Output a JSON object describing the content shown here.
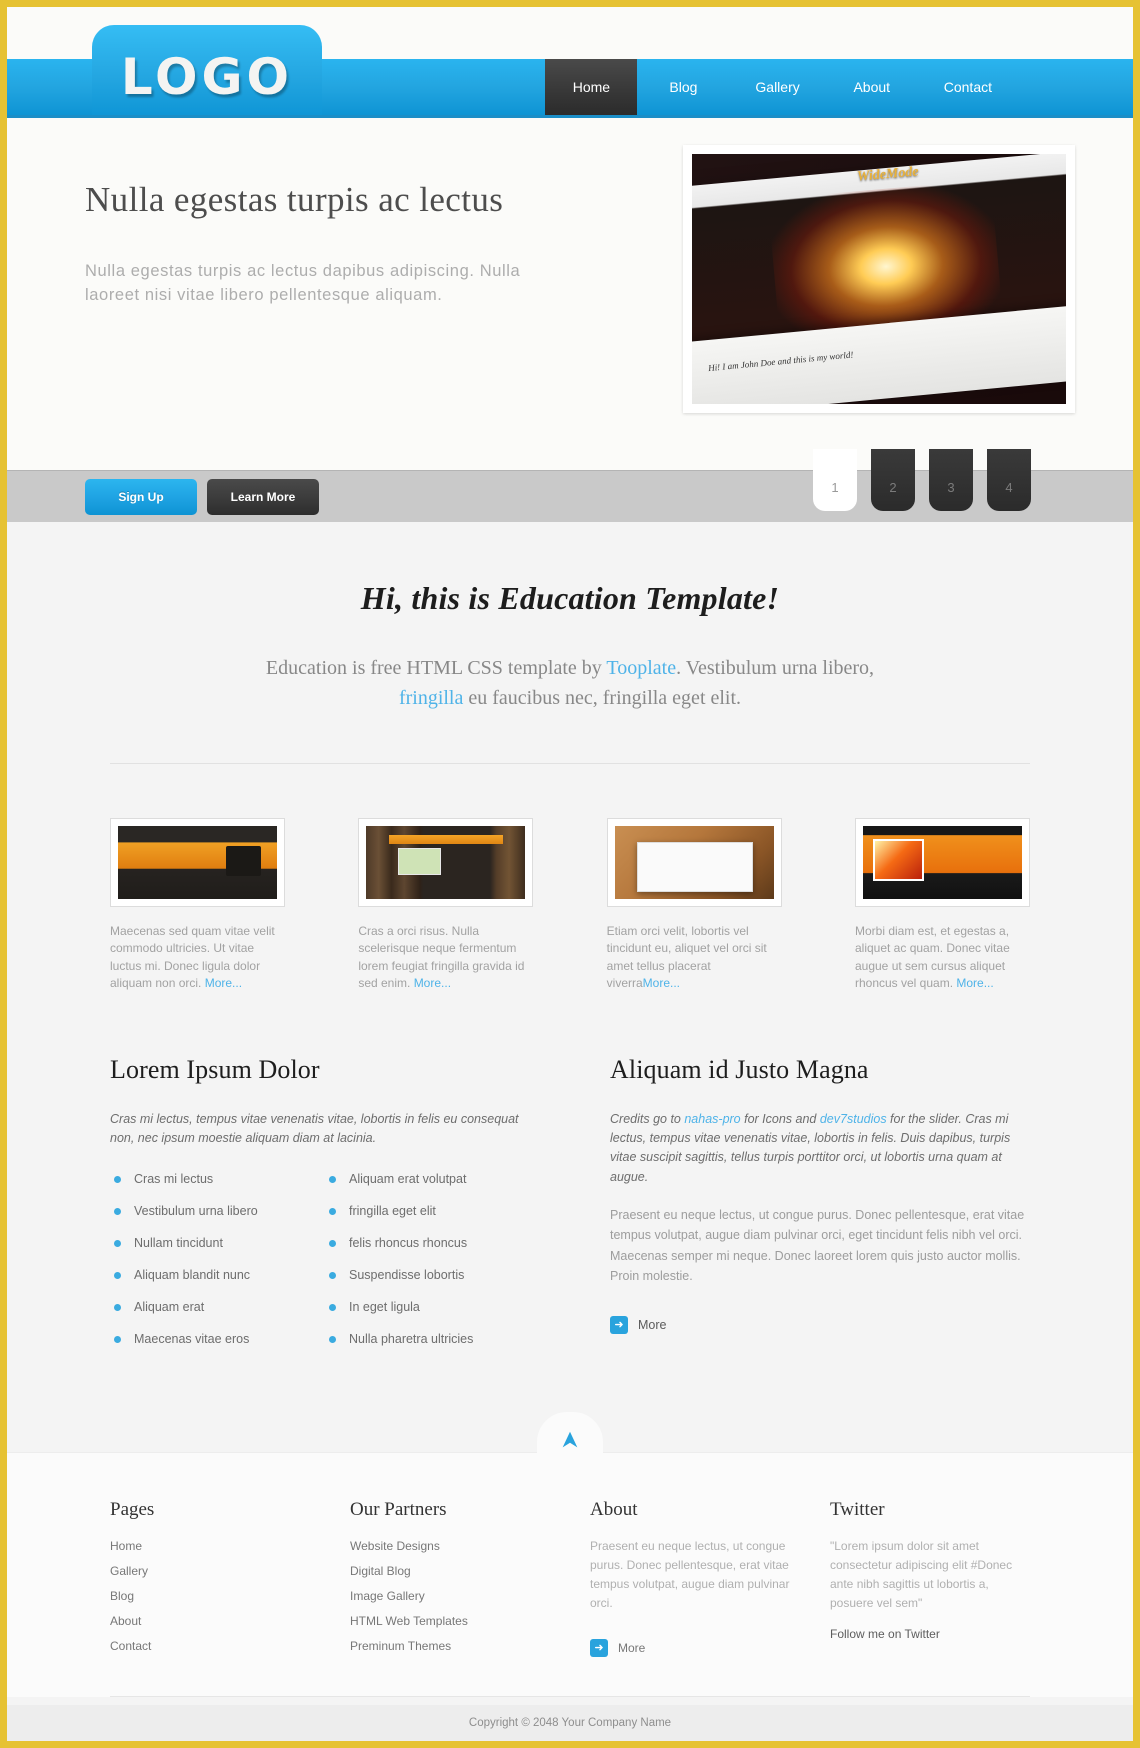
{
  "brand": {
    "logo_text": "LOGO",
    "accent": "#23a5e0",
    "frame_color": "#e6c233"
  },
  "nav": {
    "items": [
      {
        "label": "Home",
        "active": true
      },
      {
        "label": "Blog",
        "active": false
      },
      {
        "label": "Gallery",
        "active": false
      },
      {
        "label": "About",
        "active": false
      },
      {
        "label": "Contact",
        "active": false
      }
    ]
  },
  "hero": {
    "title": "Nulla egestas turpis ac lectus",
    "description": "Nulla egestas turpis ac lectus dapibus adipiscing. Nulla laoreet nisi vitae libero pellentesque aliquam.",
    "image": {
      "brand": "WideMode",
      "caption": "Hi! I am John Doe and this is my world!"
    }
  },
  "controls": {
    "signup_label": "Sign Up",
    "learnmore_label": "Learn More",
    "pager": [
      {
        "label": "1",
        "active": true
      },
      {
        "label": "2",
        "active": false
      },
      {
        "label": "3",
        "active": false
      },
      {
        "label": "4",
        "active": false
      }
    ]
  },
  "intro": {
    "heading": "Hi, this is Education Template!",
    "text_1": "Education is free HTML CSS template by ",
    "link_1": "Tooplate",
    "text_2": ". Vestibulum urna libero, ",
    "link_2": "fringilla",
    "text_3": " eu faucibus nec, fringilla eget elit."
  },
  "cards": [
    {
      "thumb": "hosting-site-thumbnail",
      "text": "Maecenas sed quam vitae velit commodo ultricies. Ut vitae luctus mi. Donec ligula dolor aliquam non orci. ",
      "more": "More..."
    },
    {
      "thumb": "wood-site-thumbnail",
      "text": "Cras a orci risus. Nulla scelerisque neque fermentum lorem feugiat fringilla gravida id sed enim. ",
      "more": "More..."
    },
    {
      "thumb": "browser-site-thumbnail",
      "text": "Etiam orci velit, lobortis vel tincidunt eu, aliquet vel orci sit amet tellus placerat viverra",
      "more": "More..."
    },
    {
      "thumb": "orange-site-thumbnail",
      "text": "Morbi diam est, et egestas a, aliquet ac quam. Donec vitae augue ut sem cursus aliquet rhoncus vel quam. ",
      "more": "More..."
    }
  ],
  "section_left": {
    "heading": "Lorem Ipsum Dolor",
    "lead": "Cras mi lectus, tempus vitae venenatis vitae, lobortis in felis eu consequat non, nec ipsum moestie aliquam diam at lacinia.",
    "list_a": [
      "Cras mi lectus",
      "Vestibulum urna libero",
      "Nullam tincidunt",
      "Aliquam blandit nunc",
      "Aliquam erat",
      "Maecenas vitae eros"
    ],
    "list_b": [
      "Aliquam erat volutpat",
      "fringilla eget elit",
      "felis rhoncus rhoncus",
      "Suspendisse lobortis",
      "In eget ligula",
      "Nulla pharetra ultricies"
    ]
  },
  "section_right": {
    "heading": "Aliquam id Justo Magna",
    "credits_1": "Credits go to ",
    "credits_link_1": "nahas-pro",
    "credits_2": " for Icons and ",
    "credits_link_2": "dev7studios",
    "credits_3": " for the slider. Cras mi lectus, tempus vitae venenatis vitae, lobortis in felis. Duis dapibus, turpis vitae suscipit sagittis, tellus turpis porttitor orci, ut lobortis urna quam at augue.",
    "body": "Praesent eu neque lectus, ut congue purus. Donec pellentesque, erat vitae tempus volutpat, augue diam pulvinar orci, eget tincidunt felis nibh vel orci. Maecenas semper mi neque. Donec laoreet lorem quis justo auctor mollis. Proin molestie.",
    "more_label": "More"
  },
  "gotop": {
    "icon": "arrow-up-icon"
  },
  "footer": {
    "pages": {
      "title": "Pages",
      "items": [
        "Home",
        "Gallery",
        "Blog",
        "About",
        "Contact"
      ]
    },
    "partners": {
      "title": "Our Partners",
      "items": [
        "Website Designs",
        "Digital Blog",
        "Image Gallery",
        "HTML Web Templates",
        "Preminum Themes"
      ]
    },
    "about": {
      "title": "About",
      "text": "Praesent eu neque lectus, ut congue purus. Donec pellentesque, erat vitae tempus volutpat, augue diam pulvinar orci.",
      "more_label": "More"
    },
    "twitter": {
      "title": "Twitter",
      "quote": "\"Lorem ipsum dolor sit amet consectetur adipiscing elit #Donec ante nibh sagittis ut lobortis a, posuere vel sem\"",
      "follow_label": "Follow me on Twitter"
    },
    "copyright": "Copyright © 2048 Your Company Name"
  }
}
